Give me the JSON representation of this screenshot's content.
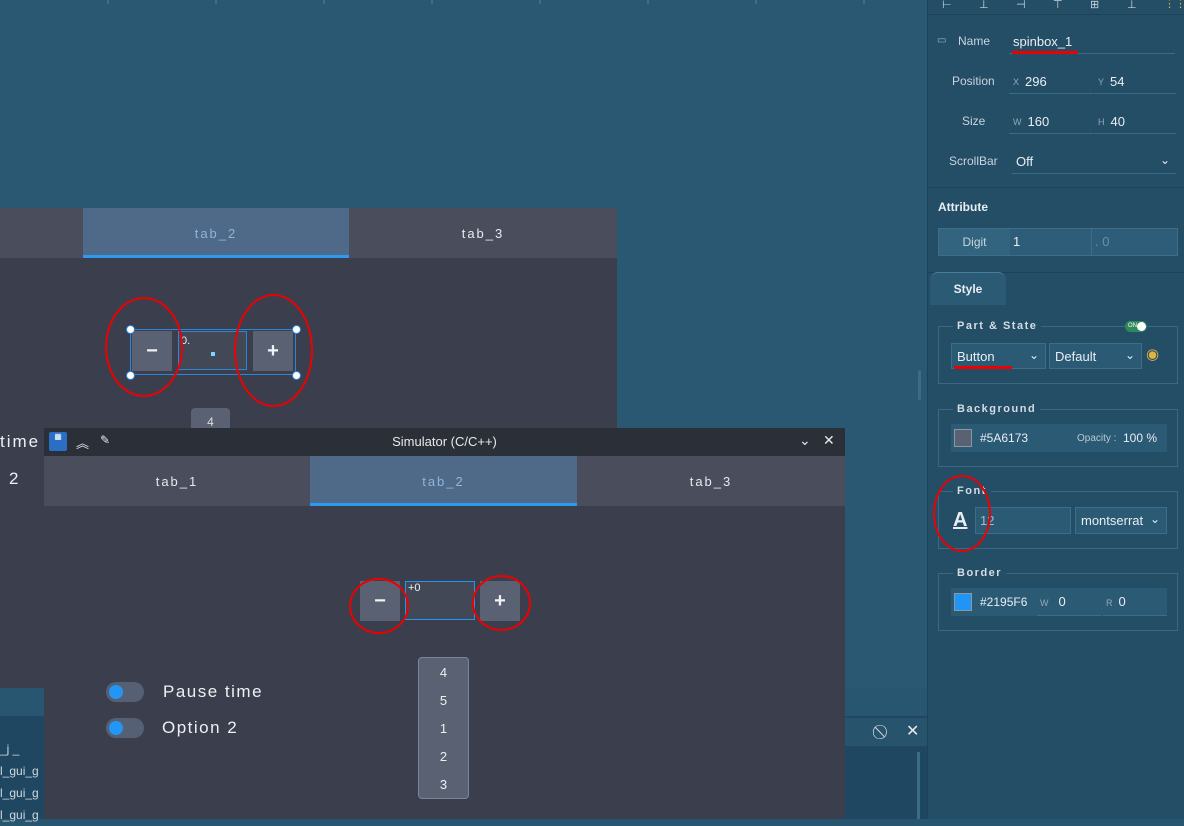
{
  "design": {
    "tabs": [
      "tab_2",
      "tab_3"
    ],
    "spinbox": {
      "minus": "−",
      "plus": "+",
      "value": "0."
    },
    "roller_peek": "4",
    "partial_label": "time",
    "partial_label2": "2"
  },
  "console": {
    "lines": [
      "_j _",
      "l_gui_g",
      "l_gui_g",
      "l_gui_g"
    ]
  },
  "panel": {
    "name_label": "Name",
    "name_value": "spinbox_1",
    "position_label": "Position",
    "pos_x_prefix": "X",
    "pos_x": "296",
    "pos_y_prefix": "Y",
    "pos_y": "54",
    "size_label": "Size",
    "size_w_prefix": "W",
    "size_w": "160",
    "size_h_prefix": "H",
    "size_h": "40",
    "scrollbar_label": "ScrollBar",
    "scrollbar_value": "Off",
    "attribute_title": "Attribute",
    "digit_label": "Digit",
    "digit_value": "1",
    "digit_decimal": ". 0",
    "style_tab": "Style",
    "part_state_title": "Part & State",
    "toggle_on": "ON",
    "part_value": "Button",
    "state_value": "Default",
    "background_title": "Background",
    "bg_color": "#5A6173",
    "opacity_label": "Opacity :",
    "opacity_value": "100 %",
    "font_title": "Font",
    "font_icon": "A",
    "font_size": "12",
    "font_family": "montserrat",
    "border_title": "Border",
    "border_color": "#2195F6",
    "border_w_prefix": "W",
    "border_w": "0",
    "border_r_prefix": "R",
    "border_r": "0"
  },
  "simulator": {
    "title": "Simulator (C/C++)",
    "tabs": [
      "tab_1",
      "tab_2",
      "tab_3"
    ],
    "spinbox": {
      "minus": "−",
      "plus": "+",
      "value": "+0"
    },
    "switch1_label": "Pause time",
    "switch2_label": "Option 2",
    "roller": [
      "4",
      "5",
      "1",
      "2",
      "3"
    ]
  },
  "colors": {
    "accent": "#2196F6",
    "button": "#5A6173",
    "annotation": "#E00000"
  }
}
